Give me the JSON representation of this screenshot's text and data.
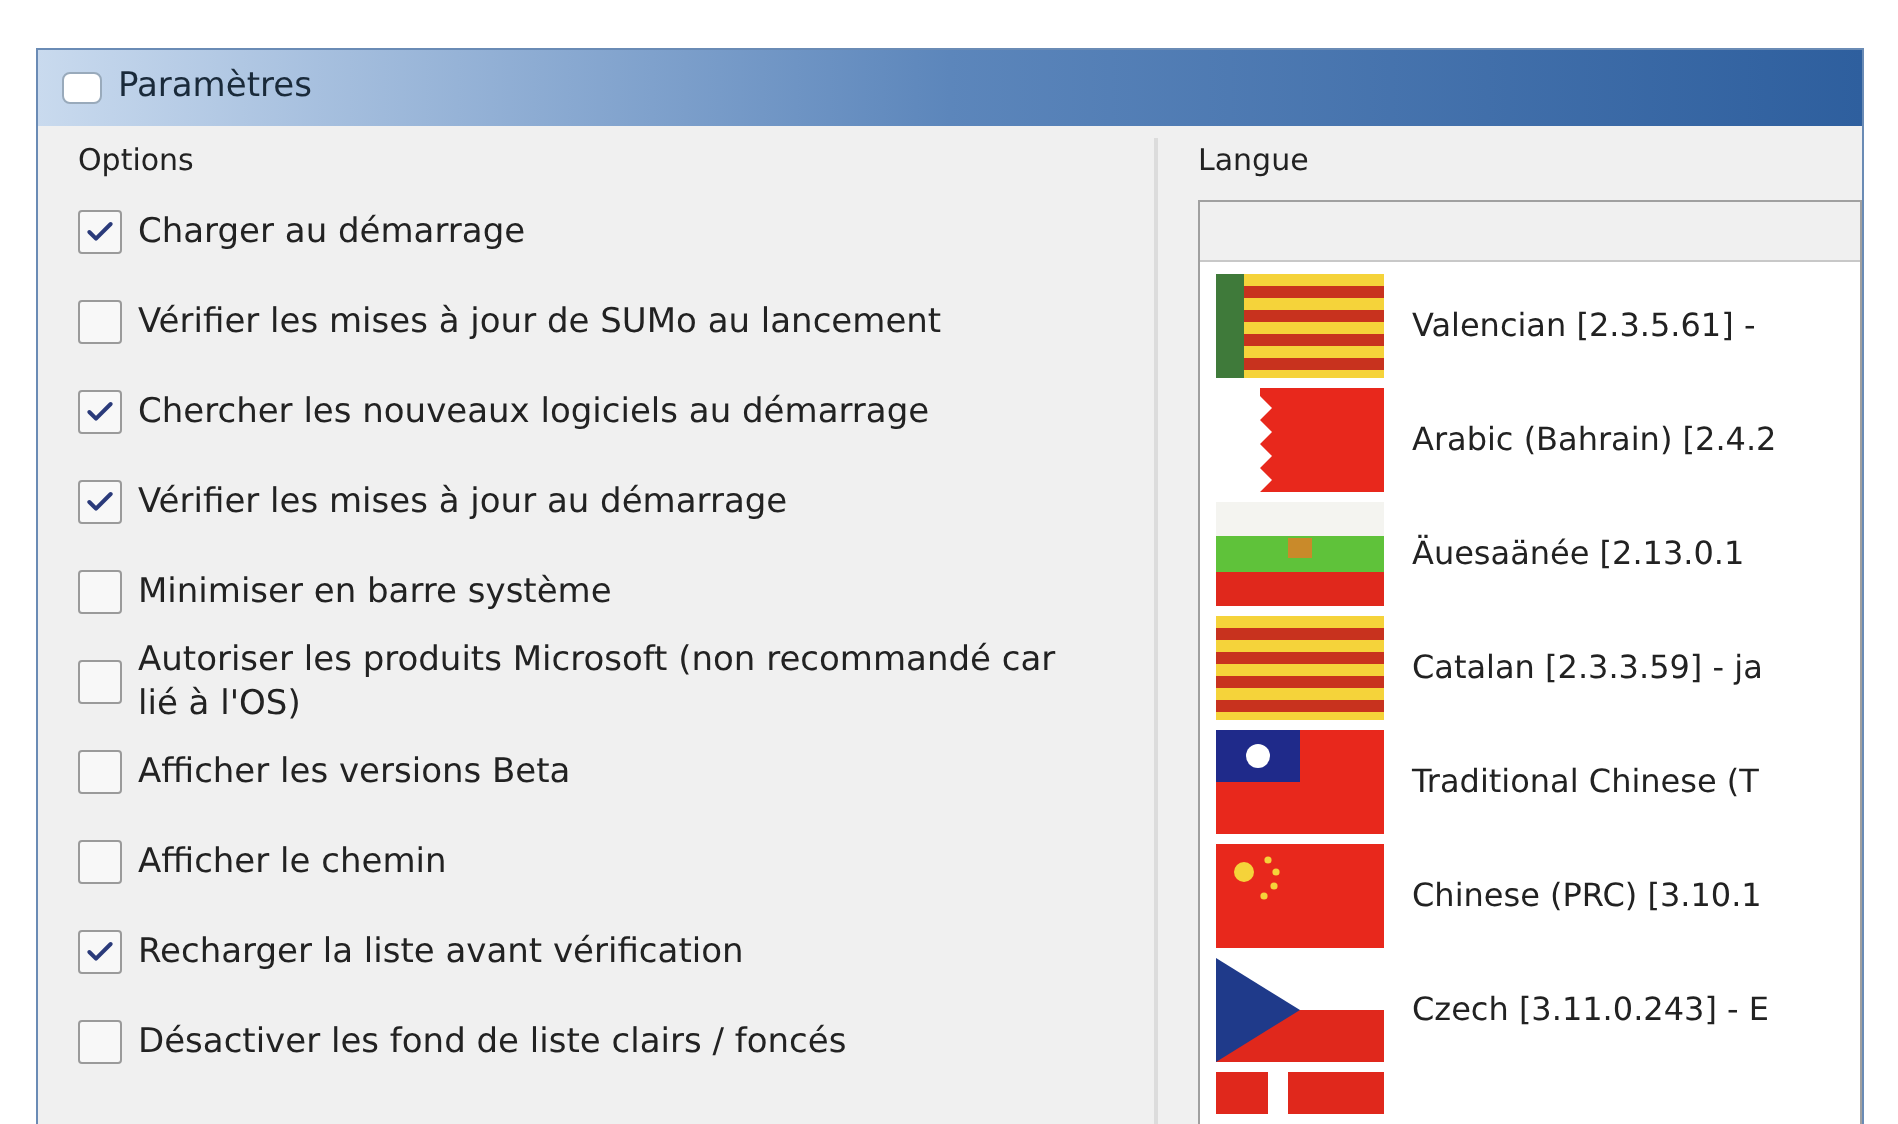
{
  "window": {
    "title": "Paramètres"
  },
  "options": {
    "title": "Options",
    "items": [
      {
        "label": "Charger au démarrage",
        "checked": true
      },
      {
        "label": "Vérifier les mises à jour de SUMo au lancement",
        "checked": false
      },
      {
        "label": "Chercher les nouveaux logiciels au démarrage",
        "checked": true
      },
      {
        "label": "Vérifier les mises à jour au démarrage",
        "checked": true
      },
      {
        "label": "Minimiser en barre système",
        "checked": false
      },
      {
        "label": "Autoriser les produits Microsoft (non recommandé car lié à l'OS)",
        "checked": false
      },
      {
        "label": "Afficher les versions Beta",
        "checked": false
      },
      {
        "label": "Afficher le chemin",
        "checked": false
      },
      {
        "label": "Recharger la liste avant vérification",
        "checked": true
      },
      {
        "label": "Désactiver les fond de liste clairs / foncés",
        "checked": false
      }
    ]
  },
  "language": {
    "title": "Langue",
    "items": [
      {
        "kind": "valencia",
        "label": "Valencian [2.3.5.61] -"
      },
      {
        "kind": "bahrain",
        "label": "Arabic (Bahrain) [2.4.2"
      },
      {
        "kind": "tricolor",
        "label": "Äuesaänée [2.13.0.1"
      },
      {
        "kind": "catalan",
        "label": "Catalan [2.3.3.59] - ja"
      },
      {
        "kind": "taiwan",
        "label": "Traditional Chinese (T"
      },
      {
        "kind": "china",
        "label": "Chinese (PRC) [3.10.1"
      },
      {
        "kind": "czech",
        "label": "Czech [3.11.0.243] - E"
      },
      {
        "kind": "denmark"
      }
    ]
  }
}
